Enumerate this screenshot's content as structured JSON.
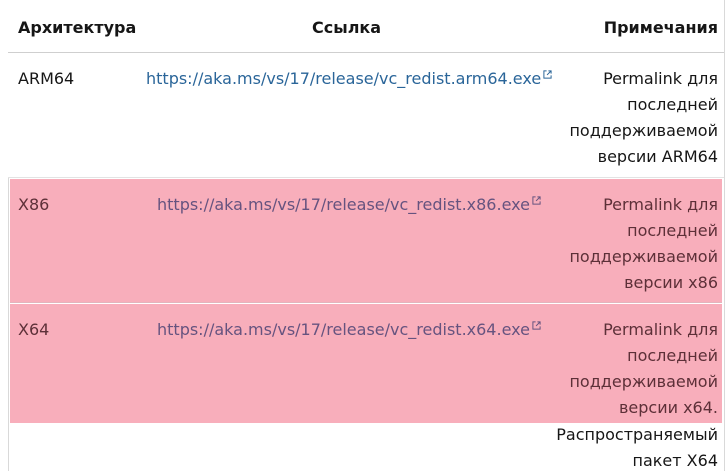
{
  "table": {
    "headers": {
      "arch": "Архитектура",
      "link": "Ссылка",
      "notes": "Примечания"
    },
    "rows": [
      {
        "arch": "ARM64",
        "link": "https://aka.ms/vs/17/release/vc_redist.arm64.exe",
        "notes": [
          "Permalink для",
          "последней",
          "поддерживаемой",
          "версии ARM64"
        ]
      },
      {
        "arch": "X86",
        "link": "https://aka.ms/vs/17/release/vc_redist.x86.exe",
        "notes": [
          "Permalink для",
          "последней",
          "поддерживаемой",
          "версии x86"
        ]
      },
      {
        "arch": "X64",
        "link": "https://aka.ms/vs/17/release/vc_redist.x64.exe",
        "notes": [
          "Permalink для",
          "последней",
          "поддерживаемой",
          "версии x64.",
          "Распространяемый",
          "пакет X64"
        ]
      }
    ]
  },
  "colors": {
    "link": "#2a6599",
    "highlight_background": "#f8aebb",
    "text": "#161616"
  },
  "icons": {
    "external_link": "external-link-icon"
  }
}
